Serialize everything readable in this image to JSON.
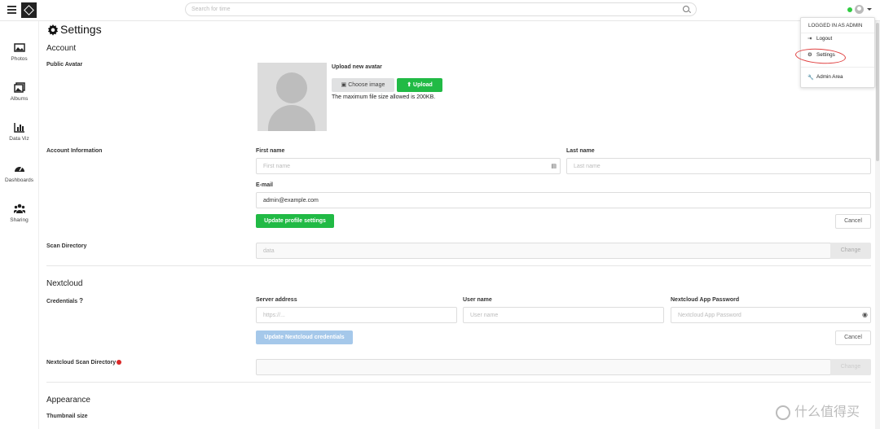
{
  "search": {
    "placeholder": "Search for time"
  },
  "sidebar": {
    "items": [
      {
        "label": "Photos"
      },
      {
        "label": "Albums"
      },
      {
        "label": "Data Viz"
      },
      {
        "label": "Dashboards"
      },
      {
        "label": "Sharing"
      }
    ]
  },
  "page": {
    "title": "Settings"
  },
  "account": {
    "heading": "Account",
    "public_avatar_label": "Public Avatar",
    "upload_new_avatar": "Upload new avatar",
    "choose_image": "Choose image",
    "upload": "Upload",
    "max_size_note": "The maximum file size allowed is 200KB.",
    "account_info_label": "Account Information",
    "first_name_label": "First name",
    "first_name_placeholder": "First name",
    "last_name_label": "Last name",
    "last_name_placeholder": "Last name",
    "email_label": "E-mail",
    "email_value": "admin@example.com",
    "update_profile": "Update profile settings",
    "cancel": "Cancel",
    "scan_directory_label": "Scan Directory",
    "scan_directory_placeholder": "data",
    "change": "Change"
  },
  "nextcloud": {
    "heading": "Nextcloud",
    "credentials_label": "Credentials",
    "credentials_help": "?",
    "server_address_label": "Server address",
    "server_address_placeholder": "https://...",
    "user_name_label": "User name",
    "user_name_placeholder": "User name",
    "app_password_label": "Nextcloud App Password",
    "app_password_placeholder": "Nextcloud App Password",
    "update_credentials": "Update Nextcloud credentials",
    "cancel": "Cancel",
    "scan_directory_label": "Nextcloud Scan Directory",
    "change": "Change"
  },
  "appearance": {
    "heading": "Appearance",
    "thumbnail_size_label": "Thumbnail size"
  },
  "user_menu": {
    "header": "LOGGED IN AS ADMIN",
    "items": [
      {
        "label": "Logout"
      },
      {
        "label": "Settings"
      },
      {
        "label": "Admin Area"
      }
    ]
  },
  "watermark": {
    "text": "什么值得买"
  },
  "colors": {
    "green": "#21ba45",
    "status_online": "#2ecc40",
    "highlight_circle": "#e04040",
    "required_dot": "#db2828"
  }
}
